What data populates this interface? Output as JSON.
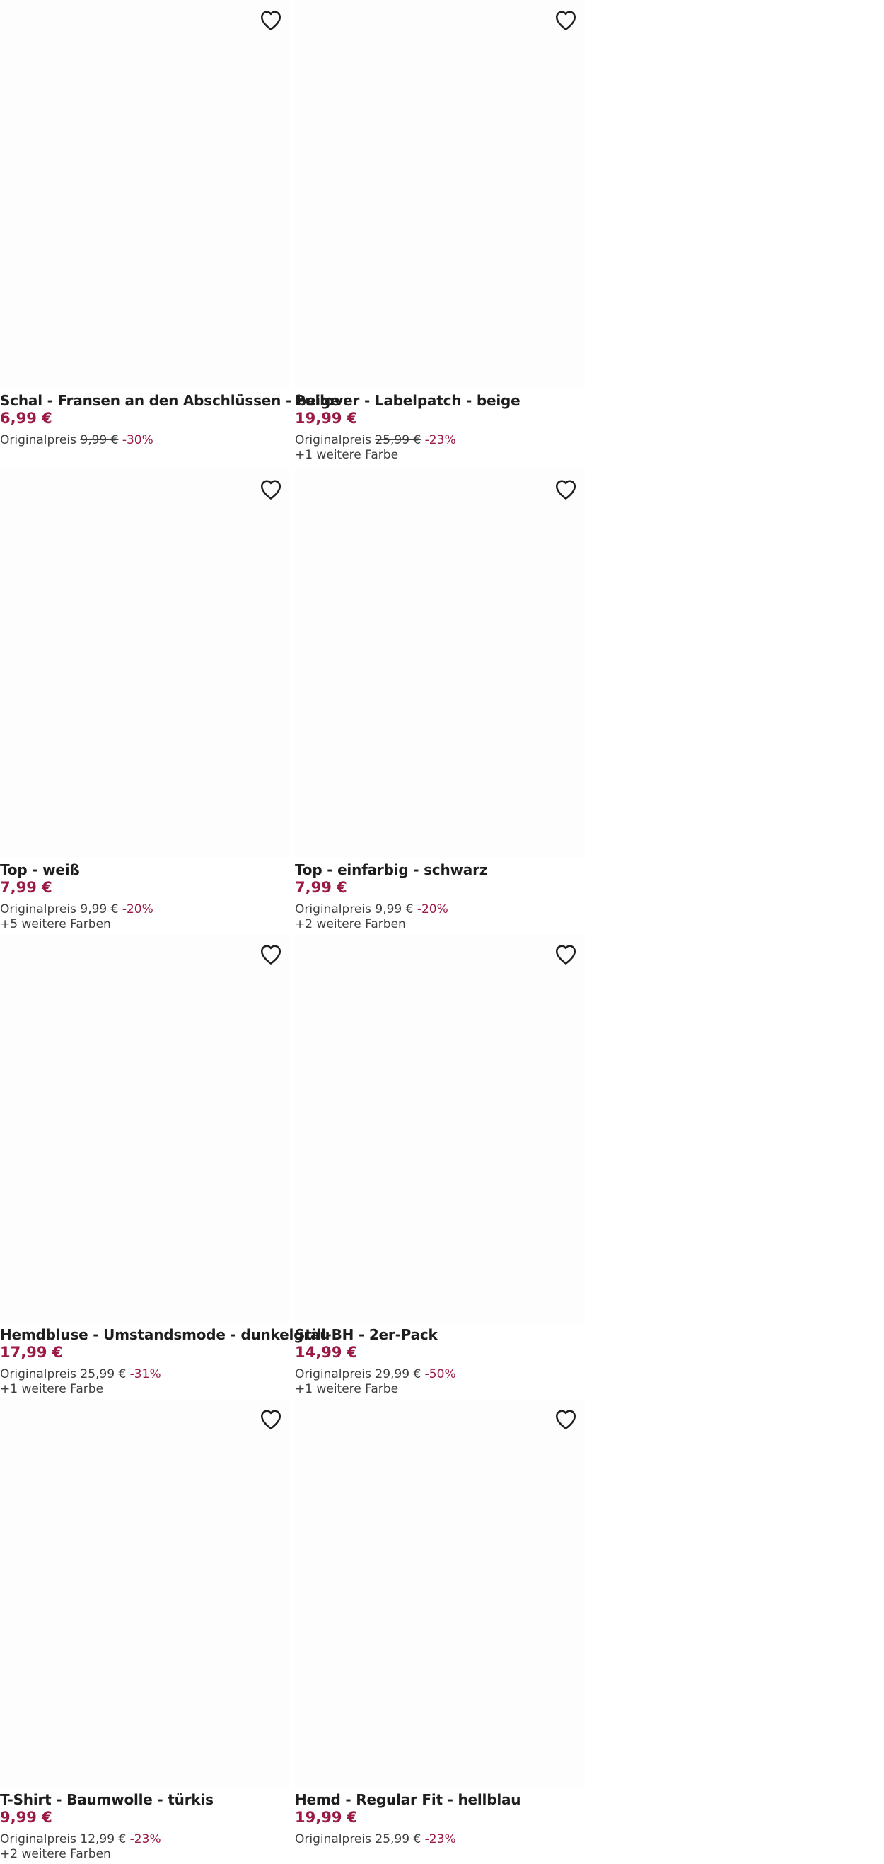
{
  "products": [
    {
      "title": "Schal - Fransen an den Abschlüssen - beige",
      "price": "6,99 €",
      "orig_label": "Originalpreis",
      "orig_price": "9,99 €",
      "discount": "-30%",
      "colors": ""
    },
    {
      "title": "Pullover - Labelpatch - beige",
      "price": "19,99 €",
      "orig_label": "Originalpreis",
      "orig_price": "25,99 €",
      "discount": "-23%",
      "colors": "+1 weitere Farbe"
    },
    {
      "title": "Top - weiß",
      "price": "7,99 €",
      "orig_label": "Originalpreis",
      "orig_price": "9,99 €",
      "discount": "-20%",
      "colors": "+5 weitere Farben"
    },
    {
      "title": "Top - einfarbig - schwarz",
      "price": "7,99 €",
      "orig_label": "Originalpreis",
      "orig_price": "9,99 €",
      "discount": "-20%",
      "colors": "+2 weitere Farben"
    },
    {
      "title": "Hemdbluse - Umstandsmode - dunkelgrau",
      "price": "17,99 €",
      "orig_label": "Originalpreis",
      "orig_price": "25,99 €",
      "discount": "-31%",
      "colors": "+1 weitere Farbe"
    },
    {
      "title": "Still-BH - 2er-Pack",
      "price": "14,99 €",
      "orig_label": "Originalpreis",
      "orig_price": "29,99 €",
      "discount": "-50%",
      "colors": "+1 weitere Farbe"
    },
    {
      "title": "T-Shirt - Baumwolle - türkis",
      "price": "9,99 €",
      "orig_label": "Originalpreis",
      "orig_price": "12,99 €",
      "discount": "-23%",
      "colors": "+2 weitere Farben"
    },
    {
      "title": "Hemd - Regular Fit - hellblau",
      "price": "19,99 €",
      "orig_label": "Originalpreis",
      "orig_price": "25,99 €",
      "discount": "-23%",
      "colors": ""
    }
  ],
  "icons": {
    "wishlist": "heart-outline-icon"
  },
  "colors": {
    "price": "#9b1a45",
    "discount": "#9b1a45",
    "title": "#1e1e1e",
    "secondary_text": "#3d3d3d"
  }
}
